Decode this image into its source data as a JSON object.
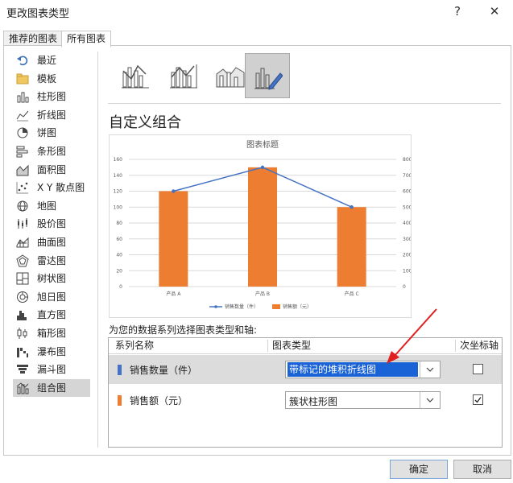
{
  "window": {
    "title": "更改图表类型",
    "help_label": "?",
    "close_label": "✕"
  },
  "tabs": [
    {
      "label": "推荐的图表",
      "active": false
    },
    {
      "label": "所有图表",
      "active": true
    }
  ],
  "sidebar": {
    "items": [
      {
        "label": "最近",
        "icon": "undo-arrow-icon"
      },
      {
        "label": "模板",
        "icon": "folder-icon"
      },
      {
        "label": "柱形图",
        "icon": "column-chart-icon"
      },
      {
        "label": "折线图",
        "icon": "line-chart-icon"
      },
      {
        "label": "饼图",
        "icon": "pie-chart-icon"
      },
      {
        "label": "条形图",
        "icon": "bar-chart-icon"
      },
      {
        "label": "面积图",
        "icon": "area-chart-icon"
      },
      {
        "label": "X Y 散点图",
        "icon": "scatter-chart-icon"
      },
      {
        "label": "地图",
        "icon": "globe-icon"
      },
      {
        "label": "股价图",
        "icon": "stock-chart-icon"
      },
      {
        "label": "曲面图",
        "icon": "surface-chart-icon"
      },
      {
        "label": "雷达图",
        "icon": "radar-chart-icon"
      },
      {
        "label": "树状图",
        "icon": "treemap-icon"
      },
      {
        "label": "旭日图",
        "icon": "sunburst-icon"
      },
      {
        "label": "直方图",
        "icon": "histogram-icon"
      },
      {
        "label": "箱形图",
        "icon": "box-whisker-icon"
      },
      {
        "label": "瀑布图",
        "icon": "waterfall-icon"
      },
      {
        "label": "漏斗图",
        "icon": "funnel-icon"
      },
      {
        "label": "组合图",
        "icon": "combo-chart-icon"
      }
    ],
    "active_index": 18
  },
  "subtypes": {
    "icons": [
      "combo-clustered-column-line-icon",
      "combo-clustered-column-line-secondary-icon",
      "combo-stacked-area-column-icon",
      "combo-custom-icon"
    ],
    "selected_index": 3
  },
  "main": {
    "section_title": "自定义组合",
    "instruction": "为您的数据系列选择图表类型和轴:"
  },
  "chart_data": {
    "type": "bar",
    "title": "图表标题",
    "categories": [
      "产品 A",
      "产品 B",
      "产品 C"
    ],
    "series": [
      {
        "name": "销售额（元）",
        "type": "bar",
        "axis": "primary",
        "color": "#ed7d31",
        "values": [
          120,
          150,
          100
        ]
      },
      {
        "name": "销售数量（件）",
        "type": "line",
        "axis": "primary",
        "color": "#4472c4",
        "values": [
          120,
          150,
          100
        ]
      }
    ],
    "y_left": {
      "min": 0,
      "max": 160,
      "ticks": [
        0,
        20,
        40,
        60,
        80,
        100,
        120,
        140,
        160
      ]
    },
    "y_right": {
      "min": 0,
      "max": 800,
      "ticks": [
        0,
        100,
        200,
        300,
        400,
        500,
        600,
        700,
        800
      ]
    },
    "grid": true,
    "legend": "bottom",
    "legend_order": [
      "销售数量（件）",
      "销售额（元）"
    ]
  },
  "series_table": {
    "headers": {
      "name": "系列名称",
      "type": "图表类型",
      "secondary": "次坐标轴"
    },
    "rows": [
      {
        "name": "销售数量（件）",
        "color": "#4472c4",
        "chart_type": "带标记的堆积折线图",
        "secondary": false
      },
      {
        "name": "销售额（元）",
        "color": "#ed7d31",
        "chart_type": "簇状柱形图",
        "secondary": true
      }
    ]
  },
  "buttons": {
    "ok": "确定",
    "cancel": "取消"
  }
}
